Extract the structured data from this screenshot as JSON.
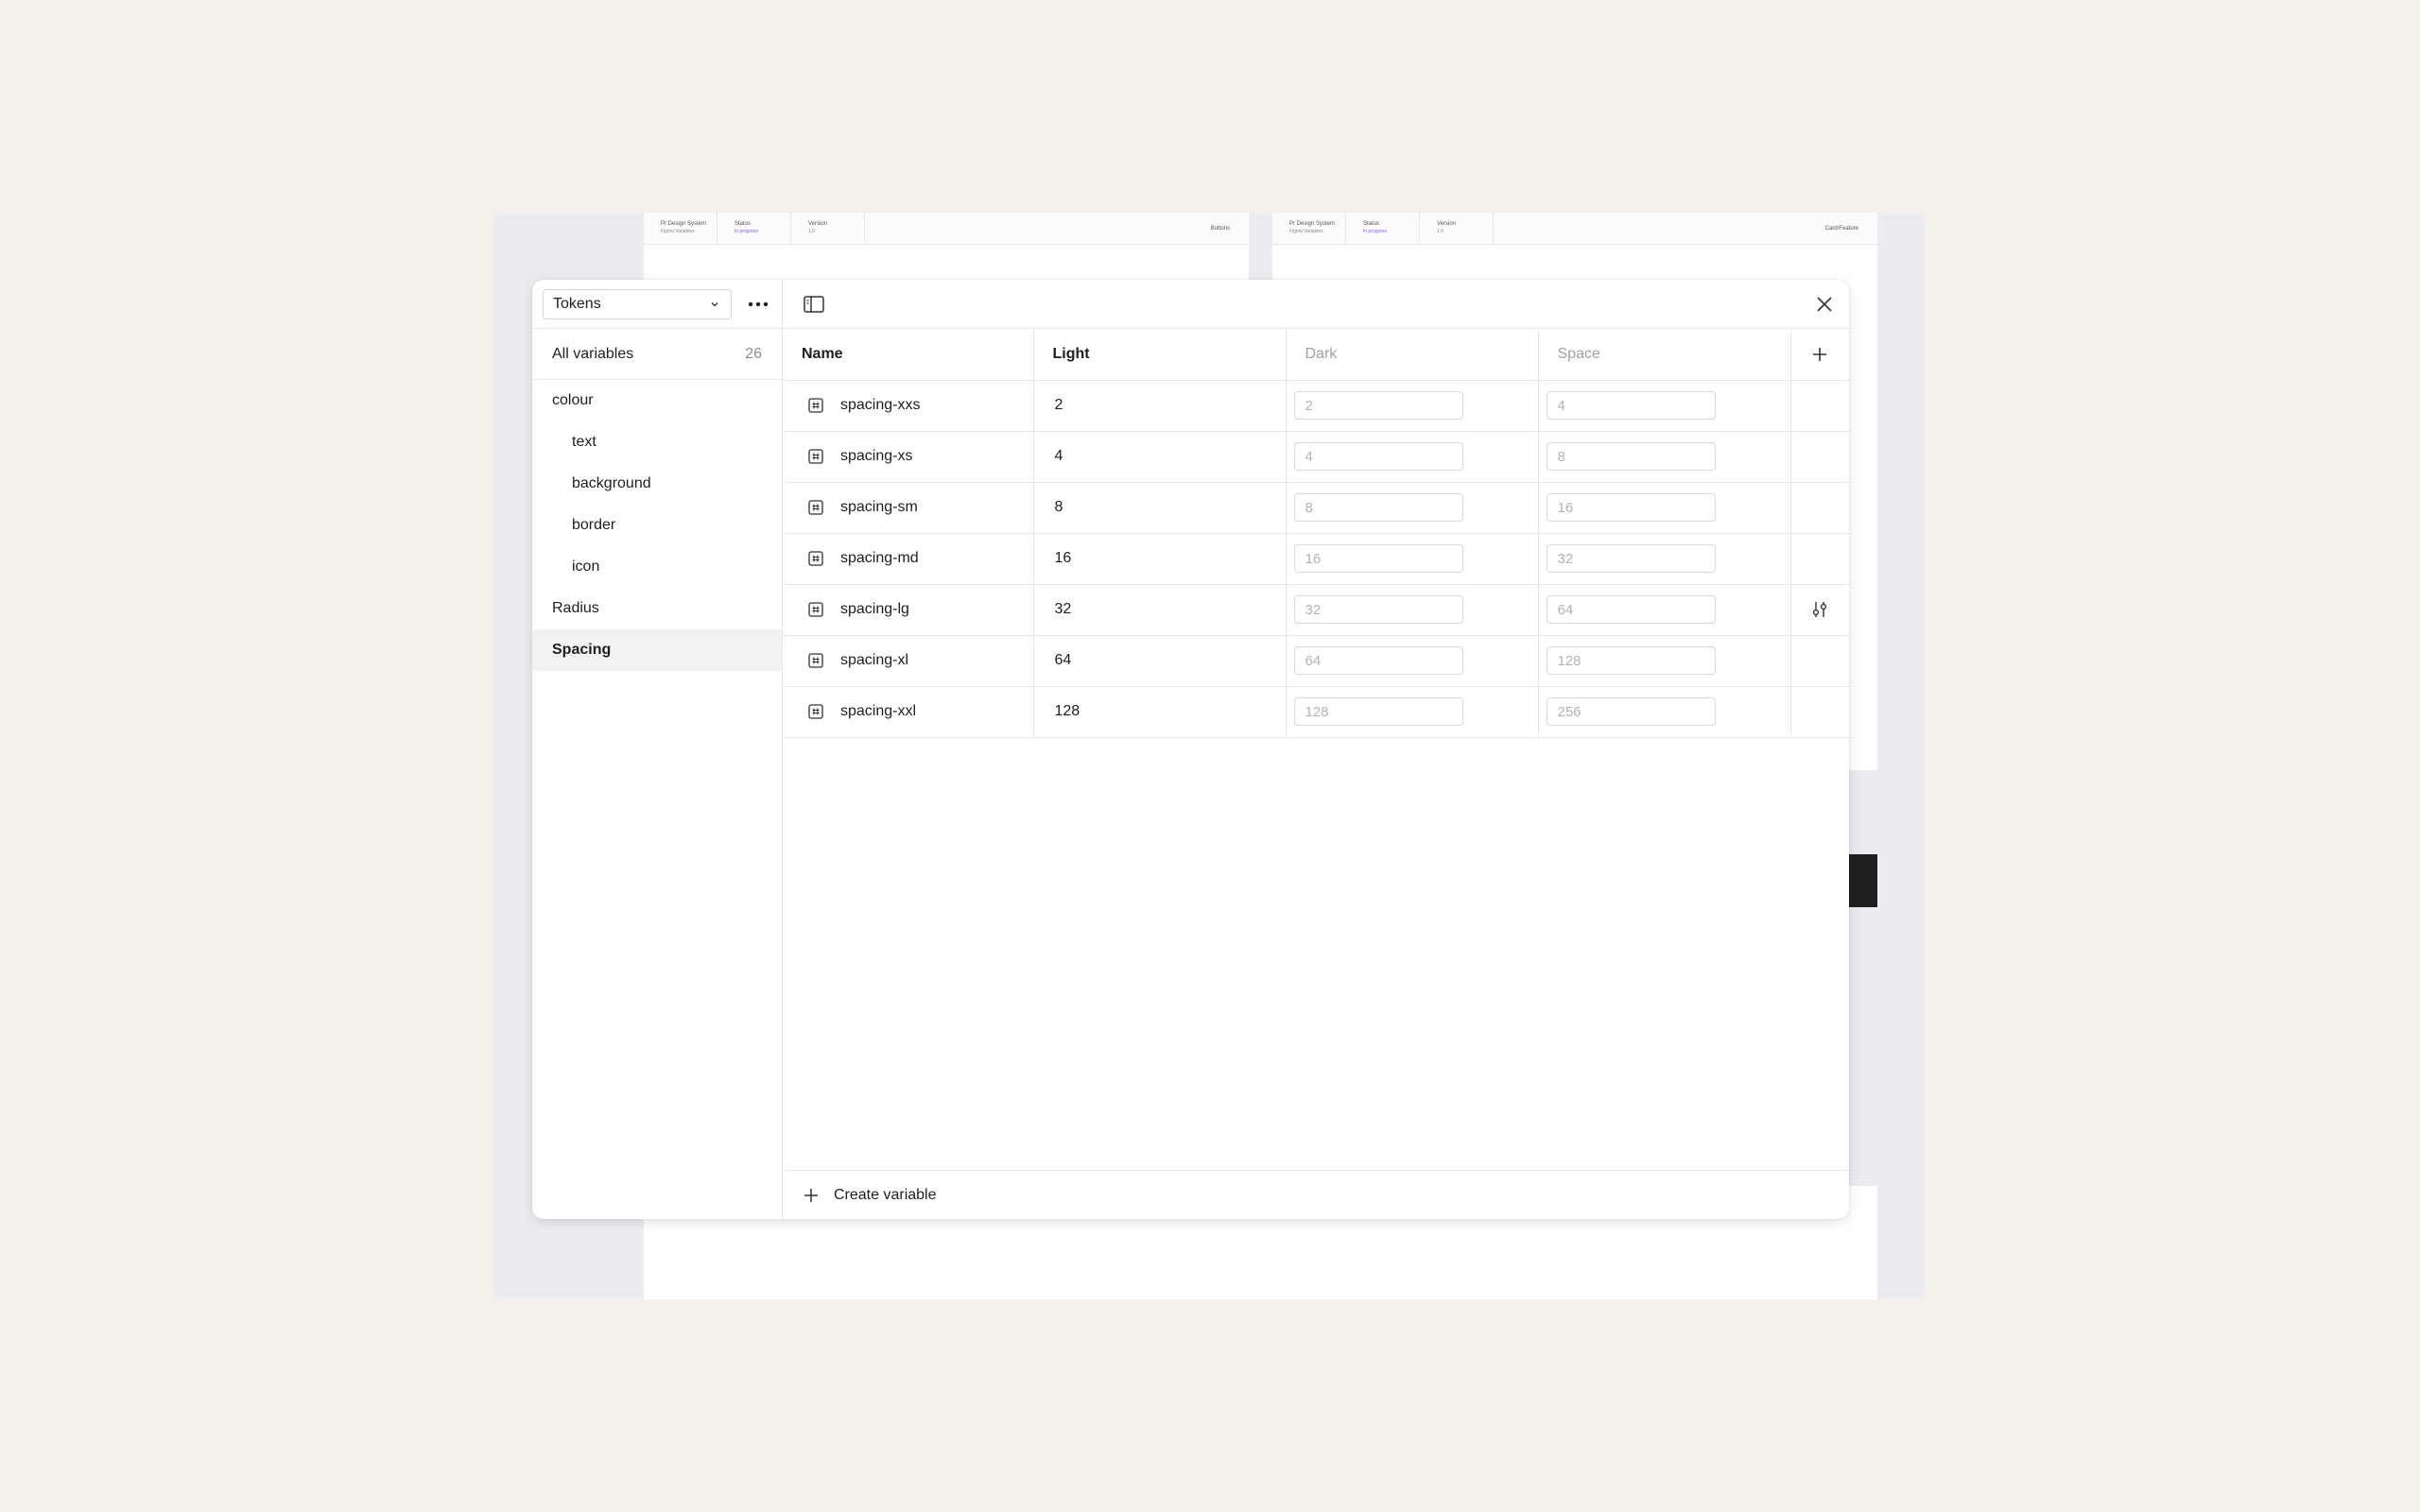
{
  "backdrop": {
    "frame_left": {
      "system_title": "Pr Design System",
      "system_sub": "Figma Variables",
      "status_title": "Status",
      "status_value": "In progress",
      "version_title": "Version",
      "version_value": "1.0",
      "page_name": "Buttons"
    },
    "frame_right": {
      "system_title": "Pr Design System",
      "system_sub": "Figma Variables",
      "status_title": "Status",
      "status_value": "In progress",
      "version_title": "Version",
      "version_value": "1.0",
      "page_name": "Card/Feature"
    }
  },
  "sidebar": {
    "collection": "Tokens",
    "all_variables_label": "All variables",
    "all_variables_count": "26",
    "groups": [
      {
        "label": "colour",
        "level": 0
      },
      {
        "label": "text",
        "level": 1
      },
      {
        "label": "background",
        "level": 1
      },
      {
        "label": "border",
        "level": 1
      },
      {
        "label": "icon",
        "level": 1
      },
      {
        "label": "Radius",
        "level": 0
      },
      {
        "label": "Spacing",
        "level": 0,
        "active": true
      }
    ]
  },
  "table": {
    "headers": {
      "name": "Name",
      "light": "Light",
      "dark": "Dark",
      "space": "Space"
    },
    "rows": [
      {
        "name": "spacing-xxs",
        "light": "2",
        "dark": "2",
        "space": "4"
      },
      {
        "name": "spacing-xs",
        "light": "4",
        "dark": "4",
        "space": "8"
      },
      {
        "name": "spacing-sm",
        "light": "8",
        "dark": "8",
        "space": "16"
      },
      {
        "name": "spacing-md",
        "light": "16",
        "dark": "16",
        "space": "32"
      },
      {
        "name": "spacing-lg",
        "light": "32",
        "dark": "32",
        "space": "64"
      },
      {
        "name": "spacing-xl",
        "light": "64",
        "dark": "64",
        "space": "128"
      },
      {
        "name": "spacing-xxl",
        "light": "128",
        "dark": "128",
        "space": "256"
      }
    ]
  },
  "footer": {
    "create_label": "Create variable"
  },
  "icons": {
    "collection_chevron": "chevron-down-icon",
    "more": "more-horizontal-icon",
    "sidebar_toggle": "sidebar-panel-icon",
    "close": "close-icon",
    "add_mode": "plus-icon",
    "variable_type": "number-variable-icon",
    "row_edit": "sliders-icon",
    "create": "plus-icon"
  },
  "colors": {
    "page_bg": "#f4f0ea",
    "canvas_bg": "#ecebf0",
    "accent": "#7b61ff",
    "active_row": "#f2f2f2"
  }
}
